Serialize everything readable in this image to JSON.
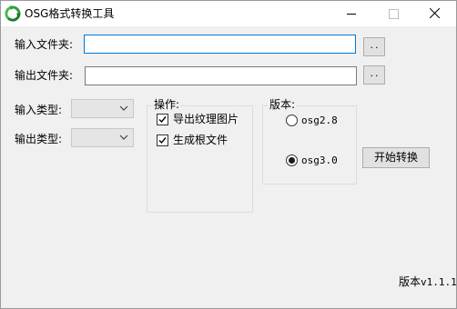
{
  "window": {
    "title": "OSG格式转换工具",
    "accent_color": "#0078d7",
    "icons": [
      "app-recycle-icon",
      "minimize-icon",
      "maximize-icon",
      "close-icon"
    ]
  },
  "form": {
    "input_folder_label": "输入文件夹:",
    "input_folder_value": "",
    "output_folder_label": "输出文件夹:",
    "output_folder_value": "",
    "browse_label": "..",
    "input_type_label": "输入类型:",
    "input_type_value": "",
    "output_type_label": "输出类型:",
    "output_type_value": ""
  },
  "operations": {
    "title": "操作:",
    "export_texture": {
      "label": "导出纹理图片",
      "checked": true
    },
    "generate_root": {
      "label": "生成根文件",
      "checked": true
    }
  },
  "version_group": {
    "title": "版本:",
    "options": [
      {
        "label": "osg2.8",
        "selected": false
      },
      {
        "label": "osg3.0",
        "selected": true
      }
    ]
  },
  "start_button": "开始转换",
  "footer": {
    "version_prefix": "版本",
    "version_number": "v1.1.1"
  }
}
